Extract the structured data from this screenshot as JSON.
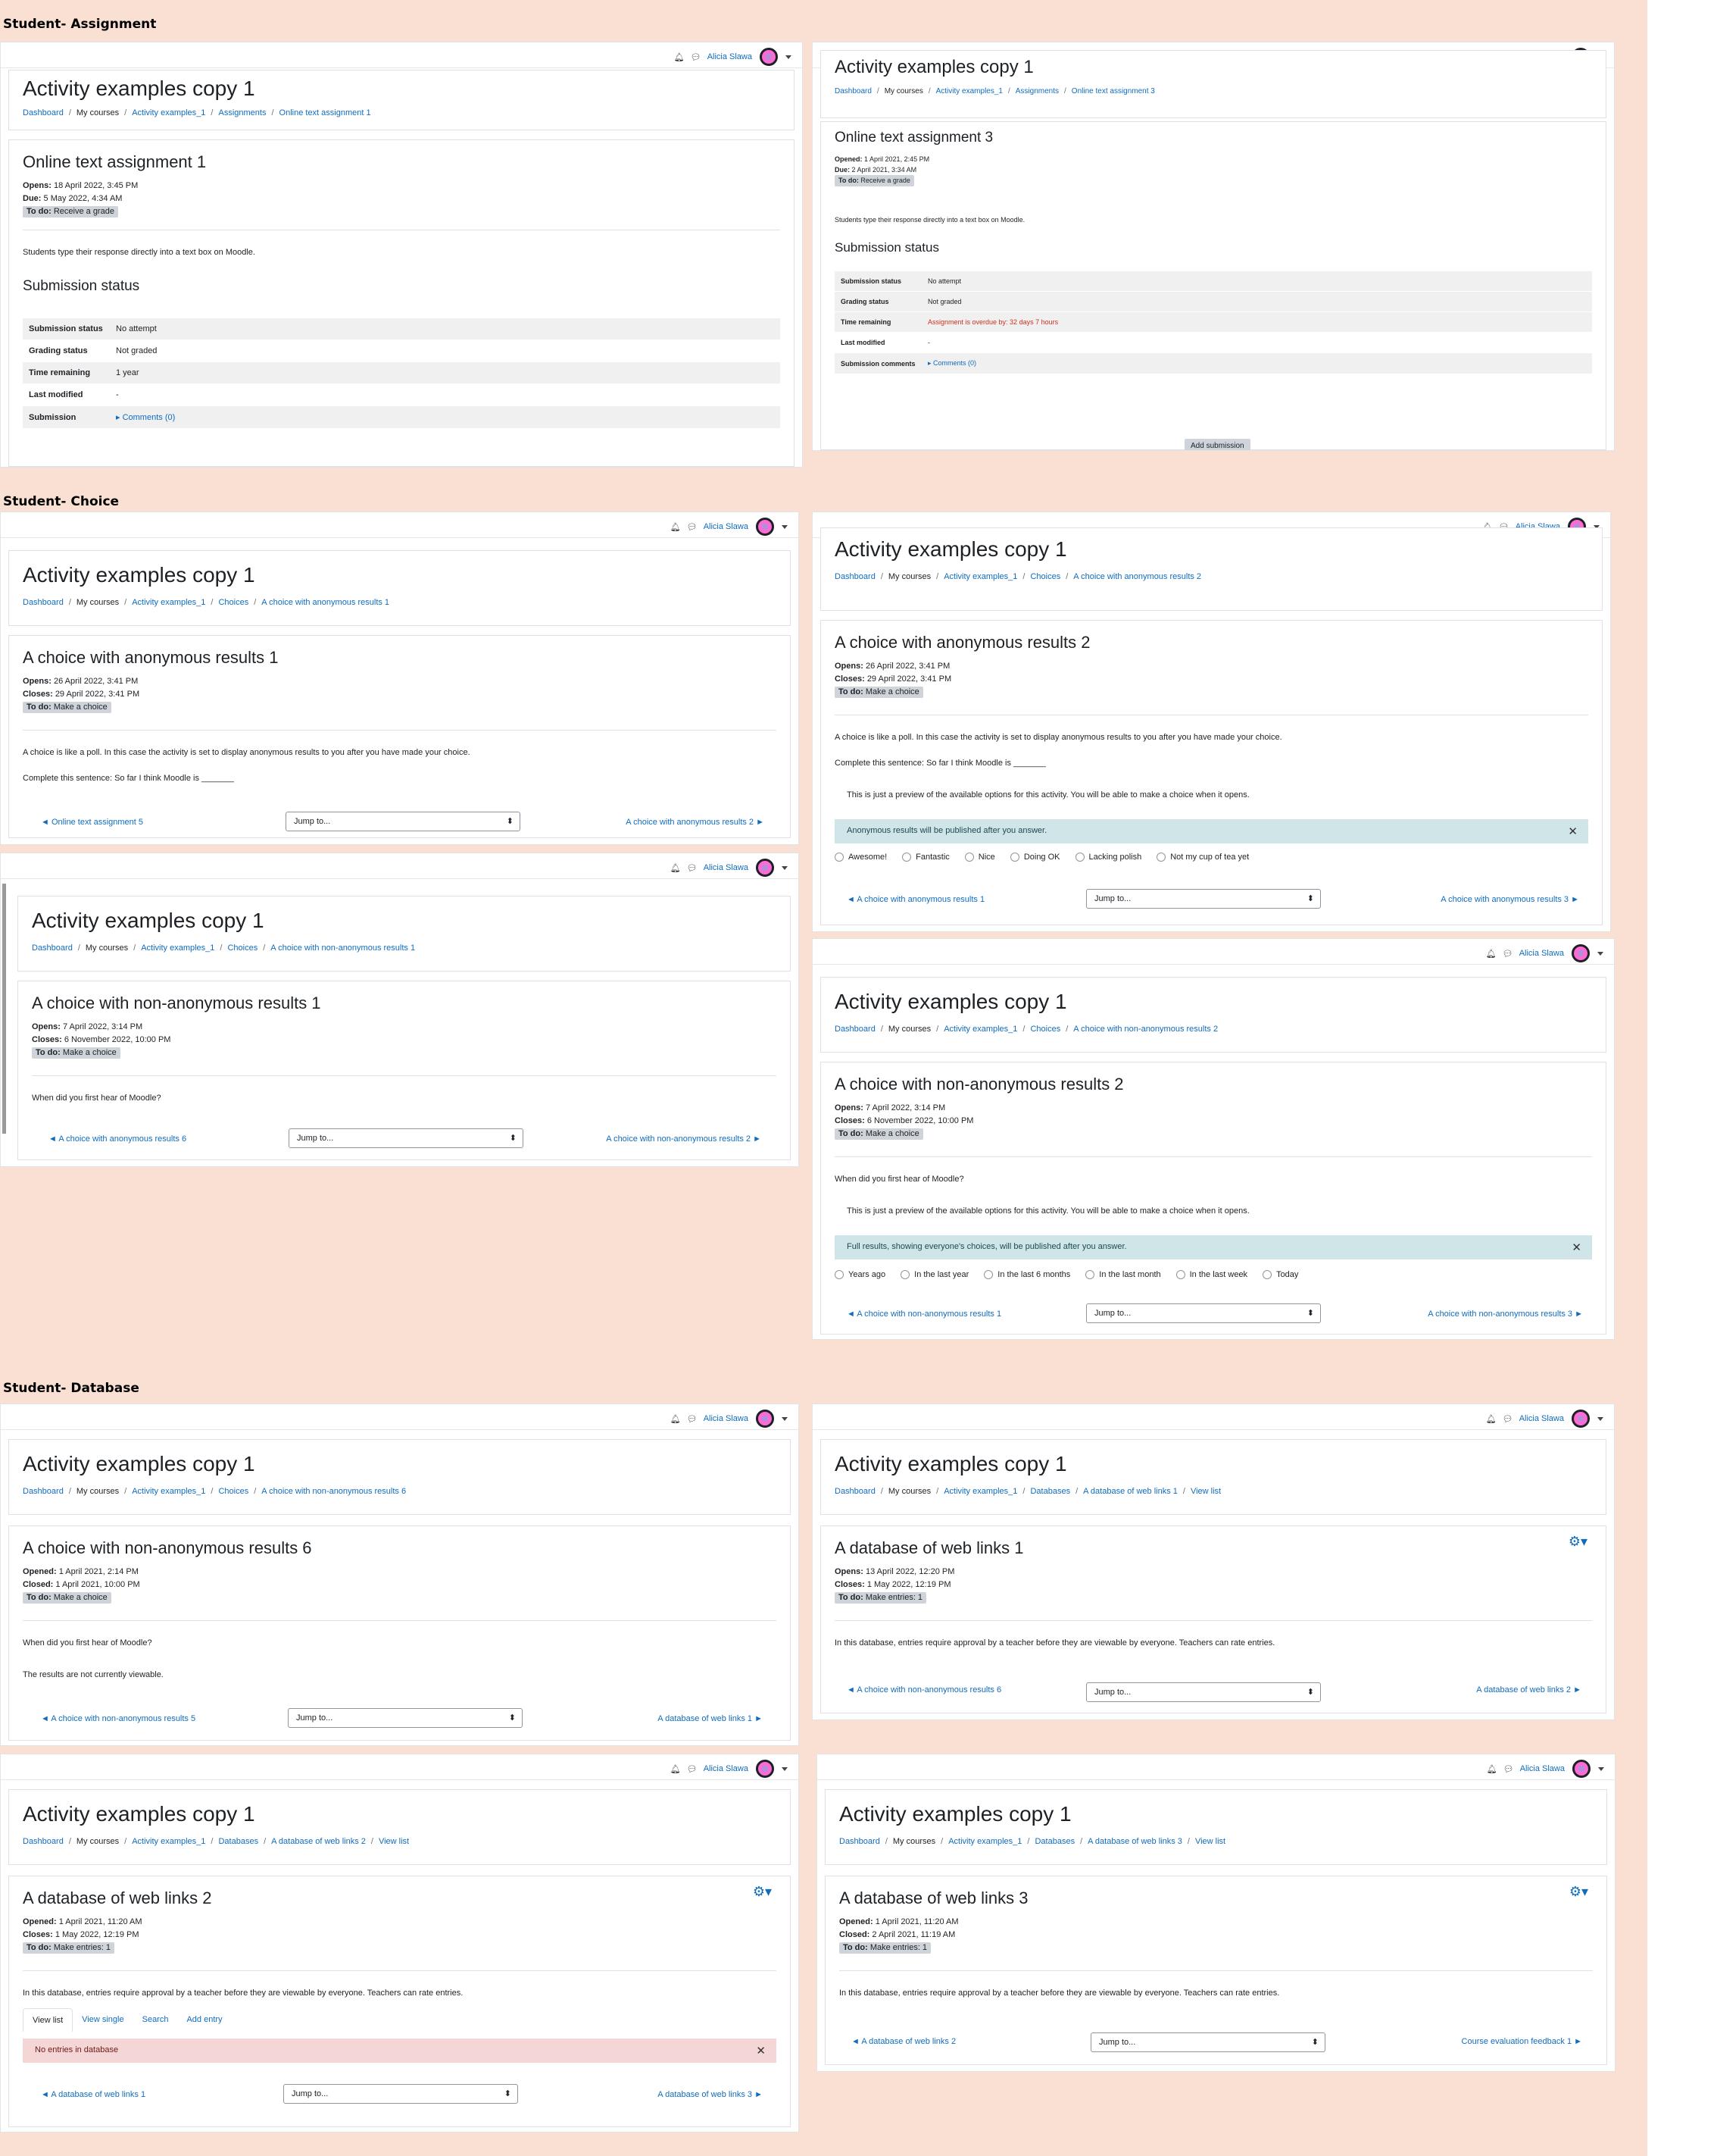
{
  "sections": {
    "assignment": "Student- Assignment",
    "choice": "Student- Choice",
    "database": "Student- Database"
  },
  "common": {
    "user_name": "Alicia Slawa",
    "course_title": "Activity examples copy 1",
    "crumb_dashboard": "Dashboard",
    "crumb_my_courses": "My courses",
    "crumb_course": "Activity examples_1",
    "jump_placeholder": "Jump to...",
    "opens_label": "Opens:",
    "due_label": "Due:",
    "closes_label": "Closes:",
    "opened_label": "Opened:",
    "closed_label": "Closed:",
    "todo_label": "To do:",
    "view_list": "View list"
  },
  "assign1": {
    "crumb_section": "Assignments",
    "crumb_activity": "Online text assignment 1",
    "title": "Online text assignment 1",
    "opens": "18 April 2022, 3:45 PM",
    "due": "5 May 2022, 4:34 AM",
    "todo": "Receive a grade",
    "desc": "Students type their response directly into a text box on Moodle.",
    "status_heading": "Submission status",
    "rows": [
      {
        "k": "Submission status",
        "v": "No attempt"
      },
      {
        "k": "Grading status",
        "v": "Not graded"
      },
      {
        "k": "Time remaining",
        "v": "1 year"
      },
      {
        "k": "Last modified",
        "v": "-"
      },
      {
        "k": "Submission",
        "v": "Comments (0)"
      }
    ]
  },
  "assign3": {
    "crumb_section": "Assignments",
    "crumb_activity": "Online text assignment 3",
    "title": "Online text assignment 3",
    "opened": "1 April 2021, 2:45 PM",
    "due": "2 April 2021, 3:34 AM",
    "todo": "Receive a grade",
    "desc": "Students type their response directly into a text box on Moodle.",
    "status_heading": "Submission status",
    "rows": [
      {
        "k": "Submission status",
        "v": "No attempt"
      },
      {
        "k": "Grading status",
        "v": "Not graded"
      },
      {
        "k": "Time remaining",
        "v": "Assignment is overdue by: 32 days 7 hours"
      },
      {
        "k": "Last modified",
        "v": "-"
      },
      {
        "k": "Submission comments",
        "v": "Comments (0)"
      }
    ],
    "add_submission": "Add submission"
  },
  "choiceA1": {
    "crumb_section": "Choices",
    "crumb_activity": "A choice with anonymous results 1",
    "title": "A choice with anonymous results 1",
    "opens": "26 April 2022, 3:41 PM",
    "closes": "29 April 2022, 3:41 PM",
    "todo": "Make a choice",
    "desc": "A choice is like a poll. In this case the activity is set to display anonymous results to you after you have made your choice.",
    "desc2": "Complete this sentence: So far I think Moodle is _______",
    "prev": "◄ Online text assignment 5",
    "next": "A choice with anonymous results 2 ►"
  },
  "choiceA2": {
    "crumb_section": "Choices",
    "crumb_activity": "A choice with anonymous results 2",
    "title": "A choice with anonymous results 2",
    "opens": "26 April 2022, 3:41 PM",
    "closes": "29 April 2022, 3:41 PM",
    "todo": "Make a choice",
    "desc": "A choice is like a poll. In this case the activity is set to display anonymous results to you after you have made your choice.",
    "desc2": "Complete this sentence: So far I think Moodle is _______",
    "preview": "This is just a preview of the available options for this activity. You will be able to make a choice when it opens.",
    "alert": "Anonymous results will be published after you answer.",
    "options": [
      "Awesome!",
      "Fantastic",
      "Nice",
      "Doing OK",
      "Lacking polish",
      "Not my cup of tea yet"
    ],
    "prev": "◄ A choice with anonymous results 1",
    "next": "A choice with anonymous results 3 ►"
  },
  "choiceN1": {
    "crumb_section": "Choices",
    "crumb_activity": "A choice with non-anonymous results 1",
    "title": "A choice with non-anonymous results 1",
    "opens": "7 April 2022, 3:14 PM",
    "closes": "6 November 2022, 10:00 PM",
    "todo": "Make a choice",
    "desc": "When did you first hear of Moodle?",
    "prev": "◄ A choice with anonymous results 6",
    "next": "A choice with non-anonymous results 2 ►"
  },
  "choiceN2": {
    "crumb_section": "Choices",
    "crumb_activity": "A choice with non-anonymous results 2",
    "title": "A choice with non-anonymous results 2",
    "opens": "7 April 2022, 3:14 PM",
    "closes": "6 November 2022, 10:00 PM",
    "todo": "Make a choice",
    "desc": "When did you first hear of Moodle?",
    "preview": "This is just a preview of the available options for this activity. You will be able to make a choice when it opens.",
    "alert": "Full results, showing everyone's choices, will be published after you answer.",
    "options": [
      "Years ago",
      "In the last year",
      "In the last 6 months",
      "In the last month",
      "In the last week",
      "Today"
    ],
    "prev": "◄ A choice with non-anonymous results 1",
    "next": "A choice with non-anonymous results 3 ►"
  },
  "choiceN6": {
    "crumb_section": "Choices",
    "crumb_activity": "A choice with non-anonymous results 6",
    "title": "A choice with non-anonymous results 6",
    "opened": "1 April 2021, 2:14 PM",
    "closed": "1 April 2021, 10:00 PM",
    "todo": "Make a choice",
    "desc": "When did you first hear of Moodle?",
    "desc2": "The results are not currently viewable.",
    "prev": "◄ A choice with non-anonymous results 5",
    "next": "A database of web links 1 ►"
  },
  "db1": {
    "crumb_section": "Databases",
    "crumb_activity": "A database of web links 1",
    "title": "A database of web links 1",
    "opens": "13 April 2022, 12:20 PM",
    "closes": "1 May 2022, 12:19 PM",
    "todo": "Make entries: 1",
    "desc": "In this database, entries require approval by a teacher before they are viewable by everyone. Teachers can rate entries.",
    "prev": "◄ A choice with non-anonymous results 6",
    "next": "A database of web links 2 ►"
  },
  "db2": {
    "crumb_section": "Databases",
    "crumb_activity": "A database of web links 2",
    "title": "A database of web links 2",
    "opened": "1 April 2021, 11:20 AM",
    "closes": "1 May 2022, 12:19 PM",
    "todo": "Make entries: 1",
    "desc": "In this database, entries require approval by a teacher before they are viewable by everyone. Teachers can rate entries.",
    "tabs": [
      "View list",
      "View single",
      "Search",
      "Add entry"
    ],
    "alert": "No entries in database",
    "prev": "◄ A database of web links 1",
    "next": "A database of web links 3 ►"
  },
  "db3": {
    "crumb_section": "Databases",
    "crumb_activity": "A database of web links 3",
    "title": "A database of web links 3",
    "opened": "1 April 2021, 11:20 AM",
    "closed": "2 April 2021, 11:19 AM",
    "todo": "Make entries: 1",
    "desc": "In this database, entries require approval by a teacher before they are viewable by everyone. Teachers can rate entries.",
    "prev": "◄ A database of web links 2",
    "next": "Course evaluation feedback 1 ►"
  }
}
